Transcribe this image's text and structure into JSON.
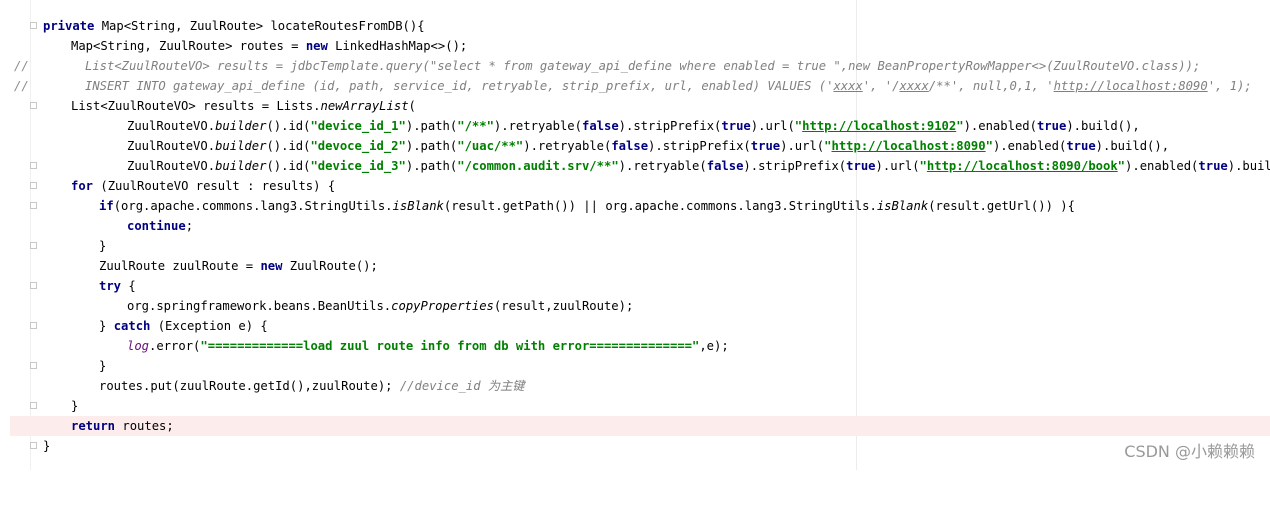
{
  "editor": {
    "lines": [
      [
        "private",
        " Map<String, ZuulRoute> locateRoutesFromDB(){"
      ],
      [
        "Map<String, ZuulRoute> routes = ",
        "new",
        " LinkedHashMap<>();"
      ],
      [
        "//",
        "List<ZuulRouteVO> results = jdbcTemplate.query(\"select * from gateway_api_define where enabled = true \",new BeanPropertyRowMapper<>(ZuulRouteVO.class));"
      ],
      [
        "//",
        "INSERT INTO gateway_api_define (id, path, service_id, retryable, strip_prefix, url, enabled) VALUES ('",
        "xxxx",
        "', '/",
        "xxxx",
        "/**', null,0,1, '",
        "http://localhost:8090",
        "', 1);"
      ],
      [
        "List<ZuulRouteVO> results = Lists.",
        "newArrayList",
        "("
      ],
      [
        "ZuulRouteVO.",
        "builder",
        "().id(",
        "\"device_id_1\"",
        ").path(",
        "\"/**\"",
        ").retryable(",
        "false",
        ").stripPrefix(",
        "true",
        ").url(",
        "\"",
        "http://localhost:9102",
        "\"",
        ").enabled(",
        "true",
        ").build(),"
      ],
      [
        "ZuulRouteVO.",
        "builder",
        "().id(",
        "\"devoce_id_2\"",
        ").path(",
        "\"/uac/**\"",
        ").retryable(",
        "false",
        ").stripPrefix(",
        "true",
        ").url(",
        "\"",
        "http://localhost:8090",
        "\"",
        ").enabled(",
        "true",
        ").build(),"
      ],
      [
        "ZuulRouteVO.",
        "builder",
        "().id(",
        "\"device_id_3\"",
        ").path(",
        "\"/common.audit.srv/**\"",
        ").retryable(",
        "false",
        ").stripPrefix(",
        "true",
        ").url(",
        "\"",
        "http://localhost:8090/book",
        "\"",
        ").enabled(",
        "true",
        ").build());"
      ],
      [
        "for",
        " (ZuulRouteVO result : results) {"
      ],
      [
        "if",
        "(org.apache.commons.lang3.StringUtils.",
        "isBlank",
        "(result.getPath()) || org.apache.commons.lang3.StringUtils.",
        "isBlank",
        "(result.getUrl()) ){"
      ],
      [
        "continue",
        ";"
      ],
      [
        "}"
      ],
      [
        "ZuulRoute zuulRoute = ",
        "new",
        " ZuulRoute();"
      ],
      [
        "try",
        " {"
      ],
      [
        "org.springframework.beans.BeanUtils.",
        "copyProperties",
        "(result,zuulRoute);"
      ],
      [
        "} ",
        "catch",
        " (Exception e) {"
      ],
      [
        "log",
        ".error(",
        "\"=============load zuul route info from db with error==============\"",
        ",e);"
      ],
      [
        "}"
      ],
      [
        "routes.put(zuulRoute.getId(),zuulRoute); ",
        "//device_id 为主键"
      ],
      [
        "}"
      ],
      [
        "return",
        " routes;"
      ],
      [
        "}"
      ]
    ]
  },
  "watermark": "CSDN @小赖赖赖"
}
